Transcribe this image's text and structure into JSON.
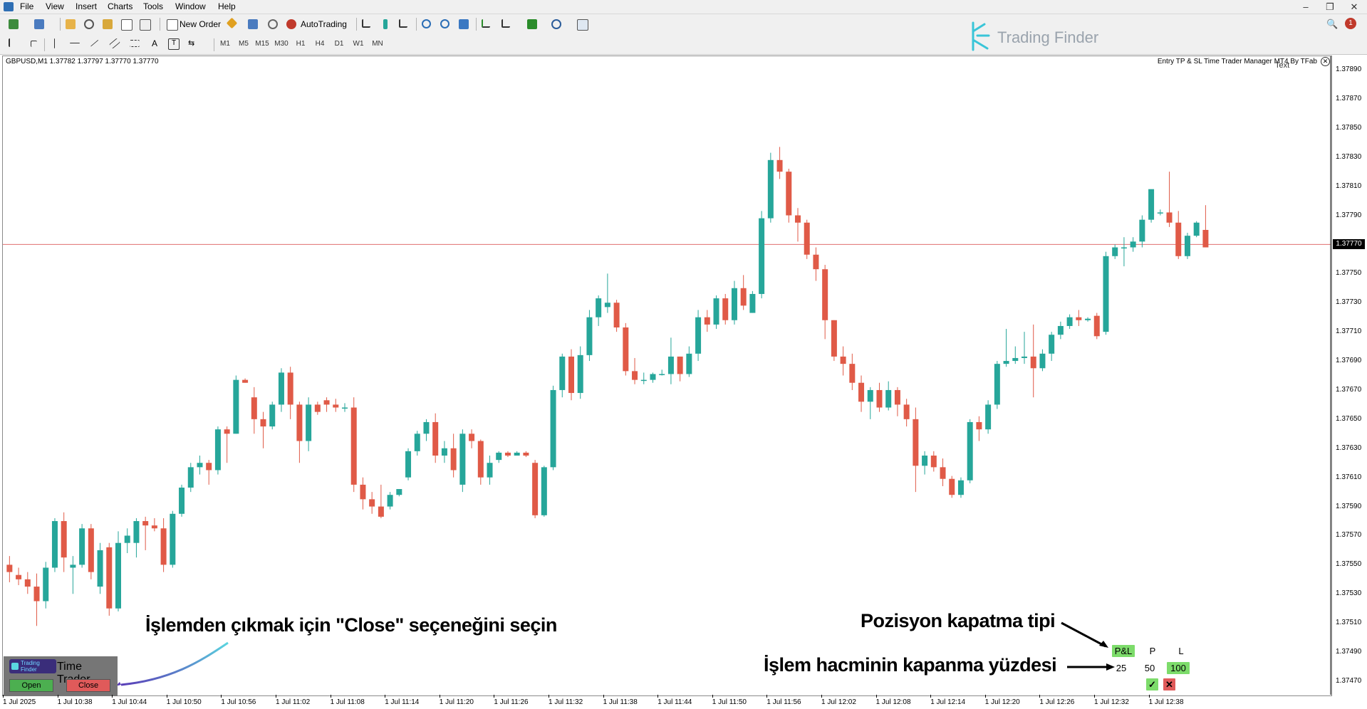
{
  "menu": {
    "items": [
      "File",
      "View",
      "Insert",
      "Charts",
      "Tools",
      "Window",
      "Help"
    ]
  },
  "toolbar": {
    "new_order_label": "New Order",
    "autotrading_label": "AutoTrading",
    "timeframes": [
      "M1",
      "M5",
      "M15",
      "M30",
      "H1",
      "H4",
      "D1",
      "W1",
      "MN"
    ],
    "notification_count": "1"
  },
  "logo": {
    "text": "Trading Finder"
  },
  "chart": {
    "symbol_info": "GBPUSD,M1  1.37782 1.37797 1.37770 1.37770",
    "indicator_title": "Entry TP & SL Time Trader Manager MT4 By TFab",
    "text_label": "Text",
    "current_price": "1.37770",
    "colors": {
      "bull": "#26a69a",
      "bear": "#e05a47",
      "price_line": "#e07070"
    }
  },
  "chart_data": {
    "type": "candlestick",
    "symbol": "GBPUSD",
    "timeframe": "M1",
    "ohlc_header": {
      "open": 1.37782,
      "high": 1.37797,
      "low": 1.3777,
      "close": 1.3777
    },
    "price_ticks": [
      "1.37890",
      "1.37870",
      "1.37850",
      "1.37830",
      "1.37810",
      "1.37790",
      "1.37770",
      "1.37750",
      "1.37730",
      "1.37710",
      "1.37690",
      "1.37670",
      "1.37650",
      "1.37630",
      "1.37610",
      "1.37590",
      "1.37570",
      "1.37550",
      "1.37530",
      "1.37510",
      "1.37490",
      "1.37470"
    ],
    "time_ticks": [
      "1 Jul 2025",
      "1 Jul 10:38",
      "1 Jul 10:44",
      "1 Jul 10:50",
      "1 Jul 10:56",
      "1 Jul 11:02",
      "1 Jul 11:08",
      "1 Jul 11:14",
      "1 Jul 11:20",
      "1 Jul 11:26",
      "1 Jul 11:32",
      "1 Jul 11:38",
      "1 Jul 11:44",
      "1 Jul 11:50",
      "1 Jul 11:56",
      "1 Jul 12:02",
      "1 Jul 12:08",
      "1 Jul 12:14",
      "1 Jul 12:20",
      "1 Jul 12:26",
      "1 Jul 12:32",
      "1 Jul 12:38"
    ],
    "ylim": [
      1.3746,
      1.379
    ],
    "current_price": 1.3777,
    "candles": [
      [
        1.3755,
        1.37556,
        1.37538,
        1.37545
      ],
      [
        1.37543,
        1.37548,
        1.37536,
        1.3754
      ],
      [
        1.3754,
        1.37545,
        1.3753,
        1.37535
      ],
      [
        1.37535,
        1.37544,
        1.37508,
        1.37525
      ],
      [
        1.37525,
        1.37552,
        1.3752,
        1.37548
      ],
      [
        1.37548,
        1.37582,
        1.37545,
        1.3758
      ],
      [
        1.3758,
        1.37586,
        1.37545,
        1.37555
      ],
      [
        1.37548,
        1.37556,
        1.3753,
        1.3755
      ],
      [
        1.3755,
        1.37578,
        1.37548,
        1.37575
      ],
      [
        1.37575,
        1.37578,
        1.3754,
        1.37545
      ],
      [
        1.37535,
        1.37565,
        1.3753,
        1.3756
      ],
      [
        1.37562,
        1.37565,
        1.37515,
        1.3752
      ],
      [
        1.3752,
        1.37573,
        1.37518,
        1.37565
      ],
      [
        1.37565,
        1.37575,
        1.37558,
        1.3757
      ],
      [
        1.37565,
        1.37582,
        1.37555,
        1.3758
      ],
      [
        1.3758,
        1.37583,
        1.3756,
        1.37577
      ],
      [
        1.37577,
        1.37582,
        1.37573,
        1.37575
      ],
      [
        1.37575,
        1.37582,
        1.37545,
        1.3755
      ],
      [
        1.3755,
        1.37587,
        1.37548,
        1.37585
      ],
      [
        1.37585,
        1.37605,
        1.37583,
        1.37603
      ],
      [
        1.37603,
        1.3762,
        1.376,
        1.37617
      ],
      [
        1.37617,
        1.37625,
        1.37612,
        1.3762
      ],
      [
        1.3762,
        1.37622,
        1.37605,
        1.37615
      ],
      [
        1.37615,
        1.37645,
        1.37612,
        1.37643
      ],
      [
        1.37643,
        1.37645,
        1.3762,
        1.3764
      ],
      [
        1.3764,
        1.3768,
        1.3764,
        1.37677
      ],
      [
        1.37677,
        1.37678,
        1.37675,
        1.37675
      ],
      [
        1.37665,
        1.37672,
        1.3764,
        1.3765
      ],
      [
        1.3765,
        1.37655,
        1.3763,
        1.37645
      ],
      [
        1.37645,
        1.37662,
        1.37643,
        1.3766
      ],
      [
        1.3766,
        1.37685,
        1.37655,
        1.37682
      ],
      [
        1.37682,
        1.37686,
        1.3765,
        1.3766
      ],
      [
        1.3766,
        1.37662,
        1.3762,
        1.37635
      ],
      [
        1.37635,
        1.37665,
        1.37628,
        1.3766
      ],
      [
        1.3766,
        1.37662,
        1.37653,
        1.37655
      ],
      [
        1.37663,
        1.37665,
        1.37655,
        1.3766
      ],
      [
        1.3766,
        1.37664,
        1.37655,
        1.37658
      ],
      [
        1.37658,
        1.37661,
        1.37655,
        1.37658
      ],
      [
        1.37658,
        1.37665,
        1.376,
        1.37605
      ],
      [
        1.37605,
        1.3761,
        1.37588,
        1.37595
      ],
      [
        1.37595,
        1.376,
        1.37585,
        1.3759
      ],
      [
        1.3759,
        1.37605,
        1.37582,
        1.37583
      ],
      [
        1.3759,
        1.376,
        1.37588,
        1.37598
      ],
      [
        1.37598,
        1.37602,
        1.37597,
        1.37602
      ],
      [
        1.3761,
        1.3763,
        1.37608,
        1.37628
      ],
      [
        1.37628,
        1.37642,
        1.37625,
        1.3764
      ],
      [
        1.3764,
        1.3765,
        1.37635,
        1.37648
      ],
      [
        1.37648,
        1.37654,
        1.3762,
        1.37625
      ],
      [
        1.37625,
        1.37635,
        1.3762,
        1.3763
      ],
      [
        1.3763,
        1.3764,
        1.3761,
        1.37615
      ],
      [
        1.37605,
        1.37643,
        1.376,
        1.3764
      ],
      [
        1.3764,
        1.37643,
        1.3763,
        1.37635
      ],
      [
        1.37635,
        1.37636,
        1.37605,
        1.3761
      ],
      [
        1.3761,
        1.37625,
        1.37605,
        1.3762
      ],
      [
        1.37622,
        1.37628,
        1.3762,
        1.37627
      ],
      [
        1.37627,
        1.37628,
        1.37624,
        1.37625
      ],
      [
        1.37625,
        1.37628,
        1.37625,
        1.37627
      ],
      [
        1.37627,
        1.37628,
        1.37624,
        1.37625
      ],
      [
        1.3762,
        1.37622,
        1.37582,
        1.37584
      ],
      [
        1.37584,
        1.37618,
        1.37583,
        1.37617
      ],
      [
        1.37617,
        1.37673,
        1.37615,
        1.3767
      ],
      [
        1.3767,
        1.37695,
        1.37665,
        1.37693
      ],
      [
        1.37693,
        1.37698,
        1.37663,
        1.37668
      ],
      [
        1.37668,
        1.377,
        1.37664,
        1.37694
      ],
      [
        1.37694,
        1.37725,
        1.3769,
        1.3772
      ],
      [
        1.3772,
        1.37735,
        1.37714,
        1.37733
      ],
      [
        1.37727,
        1.3775,
        1.37723,
        1.3773
      ],
      [
        1.3773,
        1.37732,
        1.3771,
        1.37713
      ],
      [
        1.37713,
        1.37716,
        1.3768,
        1.37683
      ],
      [
        1.37683,
        1.37692,
        1.37674,
        1.37677
      ],
      [
        1.37677,
        1.37682,
        1.37674,
        1.37677
      ],
      [
        1.37677,
        1.37682,
        1.37675,
        1.37681
      ],
      [
        1.37681,
        1.37684,
        1.3768,
        1.37681
      ],
      [
        1.37681,
        1.37706,
        1.37674,
        1.37693
      ],
      [
        1.37693,
        1.37693,
        1.37676,
        1.37681
      ],
      [
        1.37681,
        1.377,
        1.37679,
        1.37695
      ],
      [
        1.37695,
        1.37725,
        1.3769,
        1.3772
      ],
      [
        1.3772,
        1.37725,
        1.3771,
        1.37715
      ],
      [
        1.37715,
        1.37735,
        1.37712,
        1.37733
      ],
      [
        1.37733,
        1.37736,
        1.37715,
        1.37718
      ],
      [
        1.37718,
        1.37745,
        1.37715,
        1.3774
      ],
      [
        1.3774,
        1.37749,
        1.37725,
        1.37728
      ],
      [
        1.37723,
        1.37738,
        1.37723,
        1.37736
      ],
      [
        1.37736,
        1.37793,
        1.37733,
        1.37788
      ],
      [
        1.37788,
        1.37833,
        1.37785,
        1.37828
      ],
      [
        1.37828,
        1.37837,
        1.37815,
        1.3782
      ],
      [
        1.3782,
        1.37822,
        1.37785,
        1.3779
      ],
      [
        1.3779,
        1.37795,
        1.37772,
        1.37785
      ],
      [
        1.37785,
        1.37787,
        1.3776,
        1.37763
      ],
      [
        1.37763,
        1.37768,
        1.37745,
        1.37753
      ],
      [
        1.37753,
        1.37756,
        1.37705,
        1.37718
      ],
      [
        1.37718,
        1.37718,
        1.3769,
        1.37693
      ],
      [
        1.37693,
        1.377,
        1.3768,
        1.37688
      ],
      [
        1.37688,
        1.37695,
        1.3767,
        1.37675
      ],
      [
        1.37675,
        1.3768,
        1.37655,
        1.37662
      ],
      [
        1.37662,
        1.37672,
        1.3765,
        1.3767
      ],
      [
        1.3767,
        1.37675,
        1.37655,
        1.37658
      ],
      [
        1.37658,
        1.37676,
        1.37656,
        1.3767
      ],
      [
        1.3767,
        1.37672,
        1.37652,
        1.3766
      ],
      [
        1.3766,
        1.37664,
        1.37645,
        1.3765
      ],
      [
        1.3765,
        1.37658,
        1.376,
        1.37618
      ],
      [
        1.37618,
        1.37628,
        1.37612,
        1.37625
      ],
      [
        1.37625,
        1.37628,
        1.37614,
        1.37617
      ],
      [
        1.37617,
        1.37623,
        1.37604,
        1.37609
      ],
      [
        1.37609,
        1.37611,
        1.37596,
        1.37598
      ],
      [
        1.37598,
        1.3761,
        1.37596,
        1.37608
      ],
      [
        1.37608,
        1.3765,
        1.37606,
        1.37648
      ],
      [
        1.37648,
        1.37652,
        1.37635,
        1.37643
      ],
      [
        1.37643,
        1.37663,
        1.3764,
        1.3766
      ],
      [
        1.3766,
        1.3769,
        1.37657,
        1.37688
      ],
      [
        1.37688,
        1.37712,
        1.37686,
        1.3769
      ],
      [
        1.3769,
        1.377,
        1.37688,
        1.37692
      ],
      [
        1.37692,
        1.3771,
        1.37688,
        1.37693
      ],
      [
        1.37693,
        1.37715,
        1.37665,
        1.37685
      ],
      [
        1.37685,
        1.37698,
        1.37683,
        1.37695
      ],
      [
        1.37695,
        1.3771,
        1.3769,
        1.37708
      ],
      [
        1.37708,
        1.37717,
        1.37705,
        1.37714
      ],
      [
        1.37714,
        1.37722,
        1.37712,
        1.3772
      ],
      [
        1.3772,
        1.37725,
        1.37714,
        1.37718
      ],
      [
        1.37718,
        1.3772,
        1.37717,
        1.37719
      ],
      [
        1.37721,
        1.37723,
        1.37705,
        1.37707
      ],
      [
        1.3771,
        1.37765,
        1.37708,
        1.37762
      ],
      [
        1.37762,
        1.3777,
        1.3776,
        1.37768
      ],
      [
        1.37768,
        1.37775,
        1.37755,
        1.37768
      ],
      [
        1.37768,
        1.37775,
        1.37765,
        1.37772
      ],
      [
        1.37772,
        1.3779,
        1.37768,
        1.37787
      ],
      [
        1.37787,
        1.37802,
        1.37785,
        1.37808
      ],
      [
        1.37792,
        1.37794,
        1.3779,
        1.37792
      ],
      [
        1.37792,
        1.3782,
        1.37782,
        1.37785
      ],
      [
        1.37785,
        1.37793,
        1.3776,
        1.37762
      ],
      [
        1.37762,
        1.37778,
        1.3776,
        1.37776
      ],
      [
        1.37776,
        1.37786,
        1.37775,
        1.37785
      ],
      [
        1.3778,
        1.37797,
        1.37768,
        1.37768
      ]
    ]
  },
  "annotations": {
    "close_hint": "İşlemden çıkmak için \"Close\" seçeneğini seçin",
    "closing_type": "Pozisyon kapatma tipi",
    "volume_percent": "İşlem hacminin kapanma yüzdesi"
  },
  "panel": {
    "badge_text": "Trading Finder",
    "title": "Time Trader",
    "open_label": "Open",
    "close_label": "Close"
  },
  "pl_table": {
    "headers": [
      "P&L",
      "P",
      "L"
    ],
    "values": [
      "25",
      "50",
      "100"
    ],
    "confirm": "✓",
    "cancel": "✕"
  }
}
